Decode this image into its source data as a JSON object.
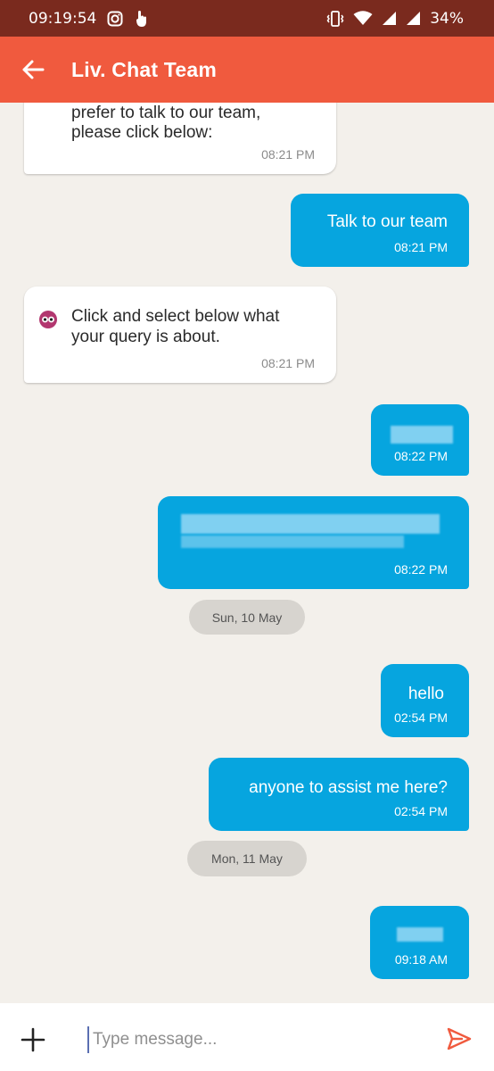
{
  "status_bar": {
    "time": "09:19:54",
    "battery": "34%",
    "icons": [
      "instagram-icon",
      "touch-icon",
      "vibrate-icon",
      "wifi-icon",
      "signal-icon",
      "signal-icon",
      "battery-icon"
    ]
  },
  "header": {
    "title": "Liv. Chat Team",
    "back_icon": "arrow-left-icon"
  },
  "messages": [
    {
      "side": "in",
      "text_line1": "prefer to talk to our team,",
      "text_line2": "please click below:",
      "time": "08:21 PM"
    },
    {
      "side": "out",
      "text": "Talk to our team",
      "time": "08:21 PM"
    },
    {
      "side": "in",
      "text_line1": "Click and select below what",
      "text_line2": "your query is about.",
      "time": "08:21 PM"
    },
    {
      "side": "out",
      "text": "",
      "time": "08:22 PM",
      "blurred": true
    },
    {
      "side": "out",
      "text": "",
      "time": "08:22 PM",
      "blurred": true
    },
    {
      "type": "date",
      "label": "Sun, 10 May"
    },
    {
      "side": "out",
      "text": "hello",
      "time": "02:54 PM"
    },
    {
      "side": "out",
      "text": "anyone to assist me here?",
      "time": "02:54 PM"
    },
    {
      "type": "date",
      "label": "Mon, 11 May"
    },
    {
      "side": "out",
      "text": "",
      "time": "09:18 AM",
      "blurred": true
    }
  ],
  "composer": {
    "placeholder": "Type message...",
    "value": ""
  },
  "colors": {
    "status_bar": "#7a2a1e",
    "app_bar": "#f05a3e",
    "outgoing_bubble": "#06a5df",
    "incoming_bubble": "#ffffff",
    "background": "#f3f0eb",
    "send": "#f05a3e"
  }
}
